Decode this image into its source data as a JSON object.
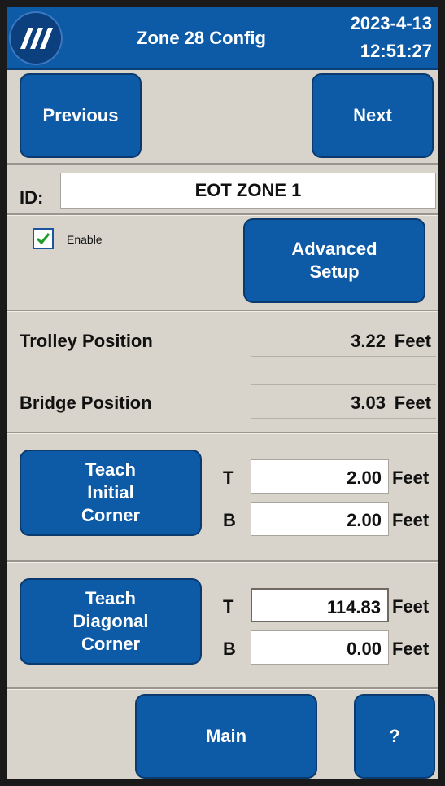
{
  "header": {
    "title": "Zone 28 Config",
    "date": "2023-4-13",
    "time": "12:51:27",
    "logo_icon": "company-logo-icon",
    "color": "#0d5aa7"
  },
  "nav": {
    "previous": "Previous",
    "next": "Next"
  },
  "id": {
    "label": "ID:",
    "value": "EOT ZONE 1"
  },
  "enable": {
    "label": "Enable",
    "checked": true
  },
  "advanced": {
    "line1": "Advanced",
    "line2": "Setup"
  },
  "positions": {
    "trolley_label": "Trolley Position",
    "trolley_value": "3.22",
    "bridge_label": "Bridge Position",
    "bridge_value": "3.03",
    "unit": "Feet"
  },
  "initial": {
    "button_lines": [
      "Teach",
      "Initial",
      "Corner"
    ],
    "t_label": "T",
    "t_value": "2.00",
    "b_label": "B",
    "b_value": "2.00",
    "unit": "Feet"
  },
  "diagonal": {
    "button_lines": [
      "Teach",
      "Diagonal",
      "Corner"
    ],
    "t_label": "T",
    "t_value": "114.83",
    "b_label": "B",
    "b_value": "0.00",
    "unit": "Feet"
  },
  "footer": {
    "main": "Main",
    "help": "?"
  }
}
